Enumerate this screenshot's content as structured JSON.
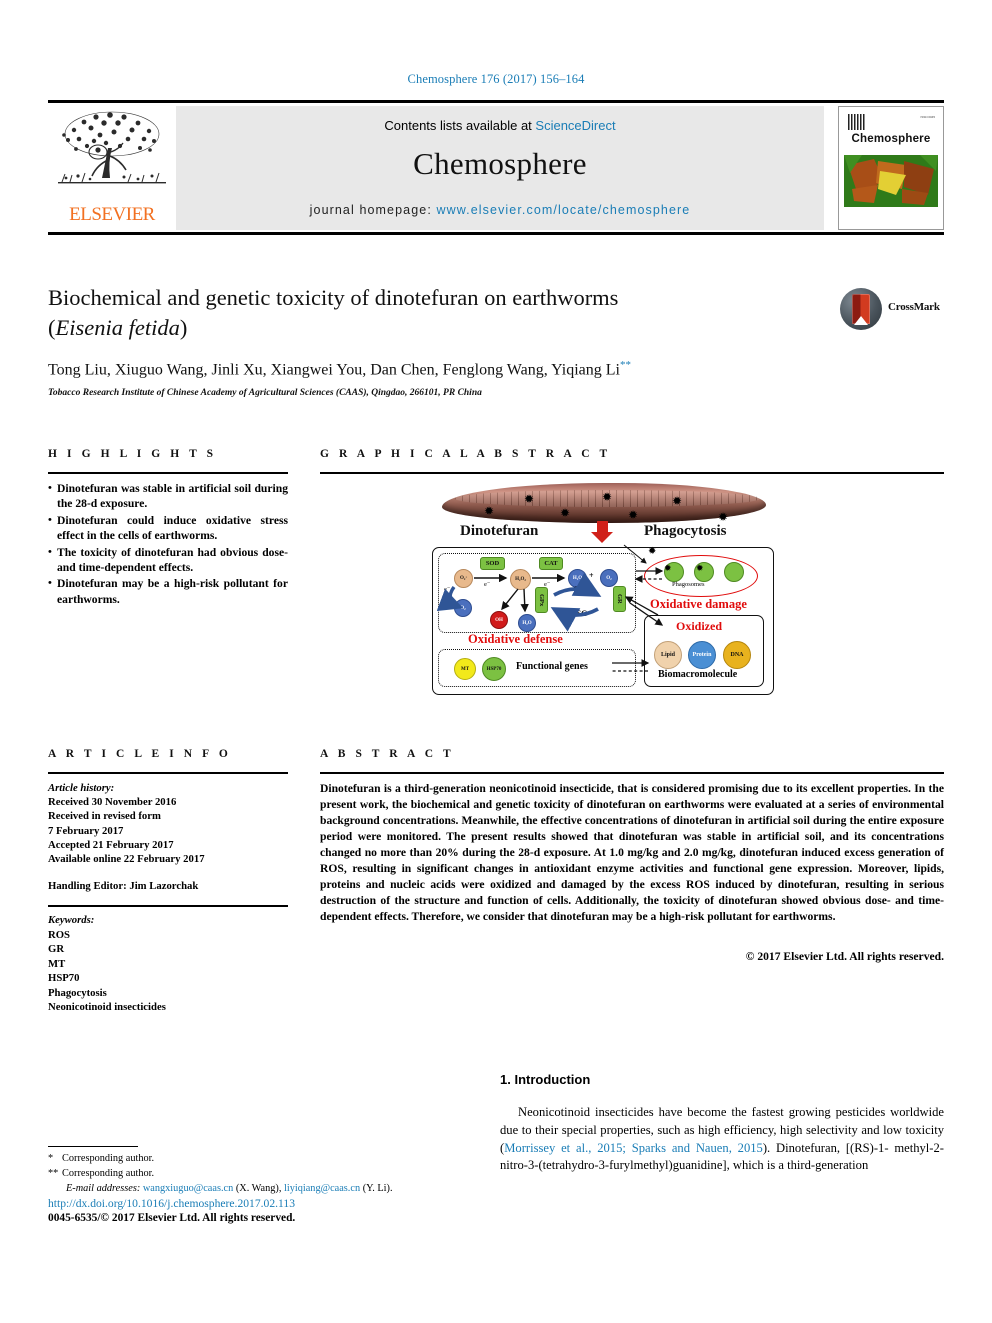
{
  "running_head": "Chemosphere 176 (2017) 156–164",
  "banner": {
    "contents_prefix": "Contents lists available at ",
    "sciencedirect": "ScienceDirect",
    "journal_name": "Chemosphere",
    "homepage_prefix": "journal homepage: ",
    "homepage_url": "www.elsevier.com/locate/chemosphere",
    "publisher": "ELSEVIER",
    "cover_title": "Chemosphere",
    "link_color": "#1a7db6"
  },
  "article": {
    "title_line1": "Biochemical and genetic toxicity of dinotefuran on earthworms",
    "title_species": "Eisenia fetida",
    "authors": "Tong Liu, Xiuguo Wang, Jinli Xu, Xiangwei You, Dan Chen, Fenglong Wang, Yiqiang Li",
    "affiliation": "Tobacco Research Institute of Chinese Academy of Agricultural Sciences (CAAS), Qingdao, 266101, PR China",
    "crossmark_label": "CrossMark"
  },
  "highlights": {
    "heading": "H I G H L I G H T S",
    "bullet": "•",
    "items": [
      "Dinotefuran was stable in artificial soil during the 28-d exposure.",
      "Dinotefuran could induce oxidative stress effect in the cells of earthworms.",
      "The toxicity of dinotefuran had obvious dose- and time-dependent effects.",
      "Dinotefuran may be a high-risk pollutant for earthworms."
    ]
  },
  "graphical_abstract": {
    "heading": "G R A P H I C A L   A B S T R A C T",
    "labels": {
      "dinotefuran": "Dinotefuran",
      "phagocytosis": "Phagocytosis",
      "oxidative_defense": "Oxidative defense",
      "oxidative_damage": "Oxidative damage",
      "oxidized": "Oxidized",
      "biomacromolecule": "Biomacromolecule",
      "functional_genes": "Functional genes",
      "phagosomes": "Phagosomes"
    },
    "nodes": {
      "sod": "SOD",
      "cat": "CAT",
      "gpx": "GPx",
      "gr": "GR",
      "o2_radical": "O₂·",
      "o2": "O₂",
      "h2o2": "H₂O₂",
      "h2o_a": "H₂O",
      "h2o_b": "H₂O",
      "o2_prod": "O₂",
      "oh": "OH",
      "gsh": "GSH",
      "gssg": "GSSG",
      "electron": "e⁻",
      "mt": "MT",
      "hsp70": "HSP70",
      "lipid": "Lipid",
      "protein": "Protein",
      "dna": "DNA"
    },
    "colors": {
      "red": "#e00c0c",
      "green": "#7cc142",
      "blue": "#4a6fbd",
      "tan": "#e8b98c",
      "yellow": "#f2e91a",
      "gold": "#e8b21e",
      "arrow_blue": "#2f5596"
    }
  },
  "article_info": {
    "heading": "A R T I C L E   I N F O",
    "history_label": "Article history:",
    "history": [
      "Received 30 November 2016",
      "Received in revised form",
      "7 February 2017",
      "Accepted 21 February 2017",
      "Available online 22 February 2017"
    ],
    "handling_editor": "Handling Editor: Jim Lazorchak",
    "keywords_label": "Keywords:",
    "keywords": [
      "ROS",
      "GR",
      "MT",
      "HSP70",
      "Phagocytosis",
      "Neonicotinoid insecticides"
    ]
  },
  "abstract": {
    "heading": "A B S T R A C T",
    "text": "Dinotefuran is a third-generation neonicotinoid insecticide, that is considered promising due to its excellent properties. In the present work, the biochemical and genetic toxicity of dinotefuran on earthworms were evaluated at a series of environmental background concentrations. Meanwhile, the effective concentrations of dinotefuran in artificial soil during the entire exposure period were monitored. The present results showed that dinotefuran was stable in artificial soil, and its concentrations changed no more than 20% during the 28-d exposure. At 1.0 mg/kg and 2.0 mg/kg, dinotefuran induced excess generation of ROS, resulting in significant changes in antioxidant enzyme activities and functional gene expression. Moreover, lipids, proteins and nucleic acids were oxidized and damaged by the excess ROS induced by dinotefuran, resulting in serious destruction of the structure and function of cells. Additionally, the toxicity of dinotefuran showed obvious dose- and time-dependent effects. Therefore, we consider that dinotefuran may be a high-risk pollutant for earthworms.",
    "copyright": "© 2017 Elsevier Ltd. All rights reserved."
  },
  "introduction": {
    "heading": "1.  Introduction",
    "para_1": "Neonicotinoid insecticides have become the fastest growing pesticides worldwide due to their special properties, such as high efficiency, high selectivity and low toxicity (",
    "citation_1": "Morrissey et al., 2015; Sparks and Nauen, 2015",
    "para_2": "). Dinotefuran, [(RS)-1- methyl-2-nitro-3-(tetrahydro-3-furylmethyl)guanidine], which is a third-generation"
  },
  "footer": {
    "corresponding_1_mark": "*",
    "corresponding_1": "Corresponding author.",
    "corresponding_2_mark": "**",
    "corresponding_2": "Corresponding author.",
    "email_label": "E-mail addresses:",
    "email_1": "wangxiuguo@caas.cn",
    "email_1_name": "(X. Wang),",
    "email_2": "liyiqiang@caas.cn",
    "email_2_name": "(Y. Li).",
    "doi": "http://dx.doi.org/10.1016/j.chemosphere.2017.02.113",
    "issn": "0045-6535/© 2017 Elsevier Ltd. All rights reserved."
  }
}
